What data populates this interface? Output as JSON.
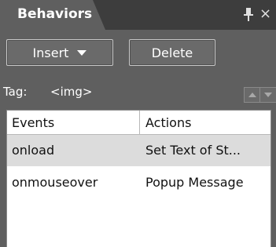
{
  "panel": {
    "title": "Behaviors",
    "icons": {
      "pin": "pin-icon",
      "close": "close-icon"
    }
  },
  "toolbar": {
    "insert_label": "Insert",
    "delete_label": "Delete"
  },
  "tag": {
    "label": "Tag:",
    "value": "<img>"
  },
  "table": {
    "headers": [
      "Events",
      "Actions"
    ],
    "rows": [
      {
        "event": "onload",
        "action": "Set Text of St...",
        "selected": true
      },
      {
        "event": "onmouseover",
        "action": "Popup Message",
        "selected": false
      }
    ]
  },
  "colors": {
    "panel_bg": "#5f5f5f",
    "title_strip": "#3d3d3d",
    "selected_row": "#dcdcdc"
  }
}
